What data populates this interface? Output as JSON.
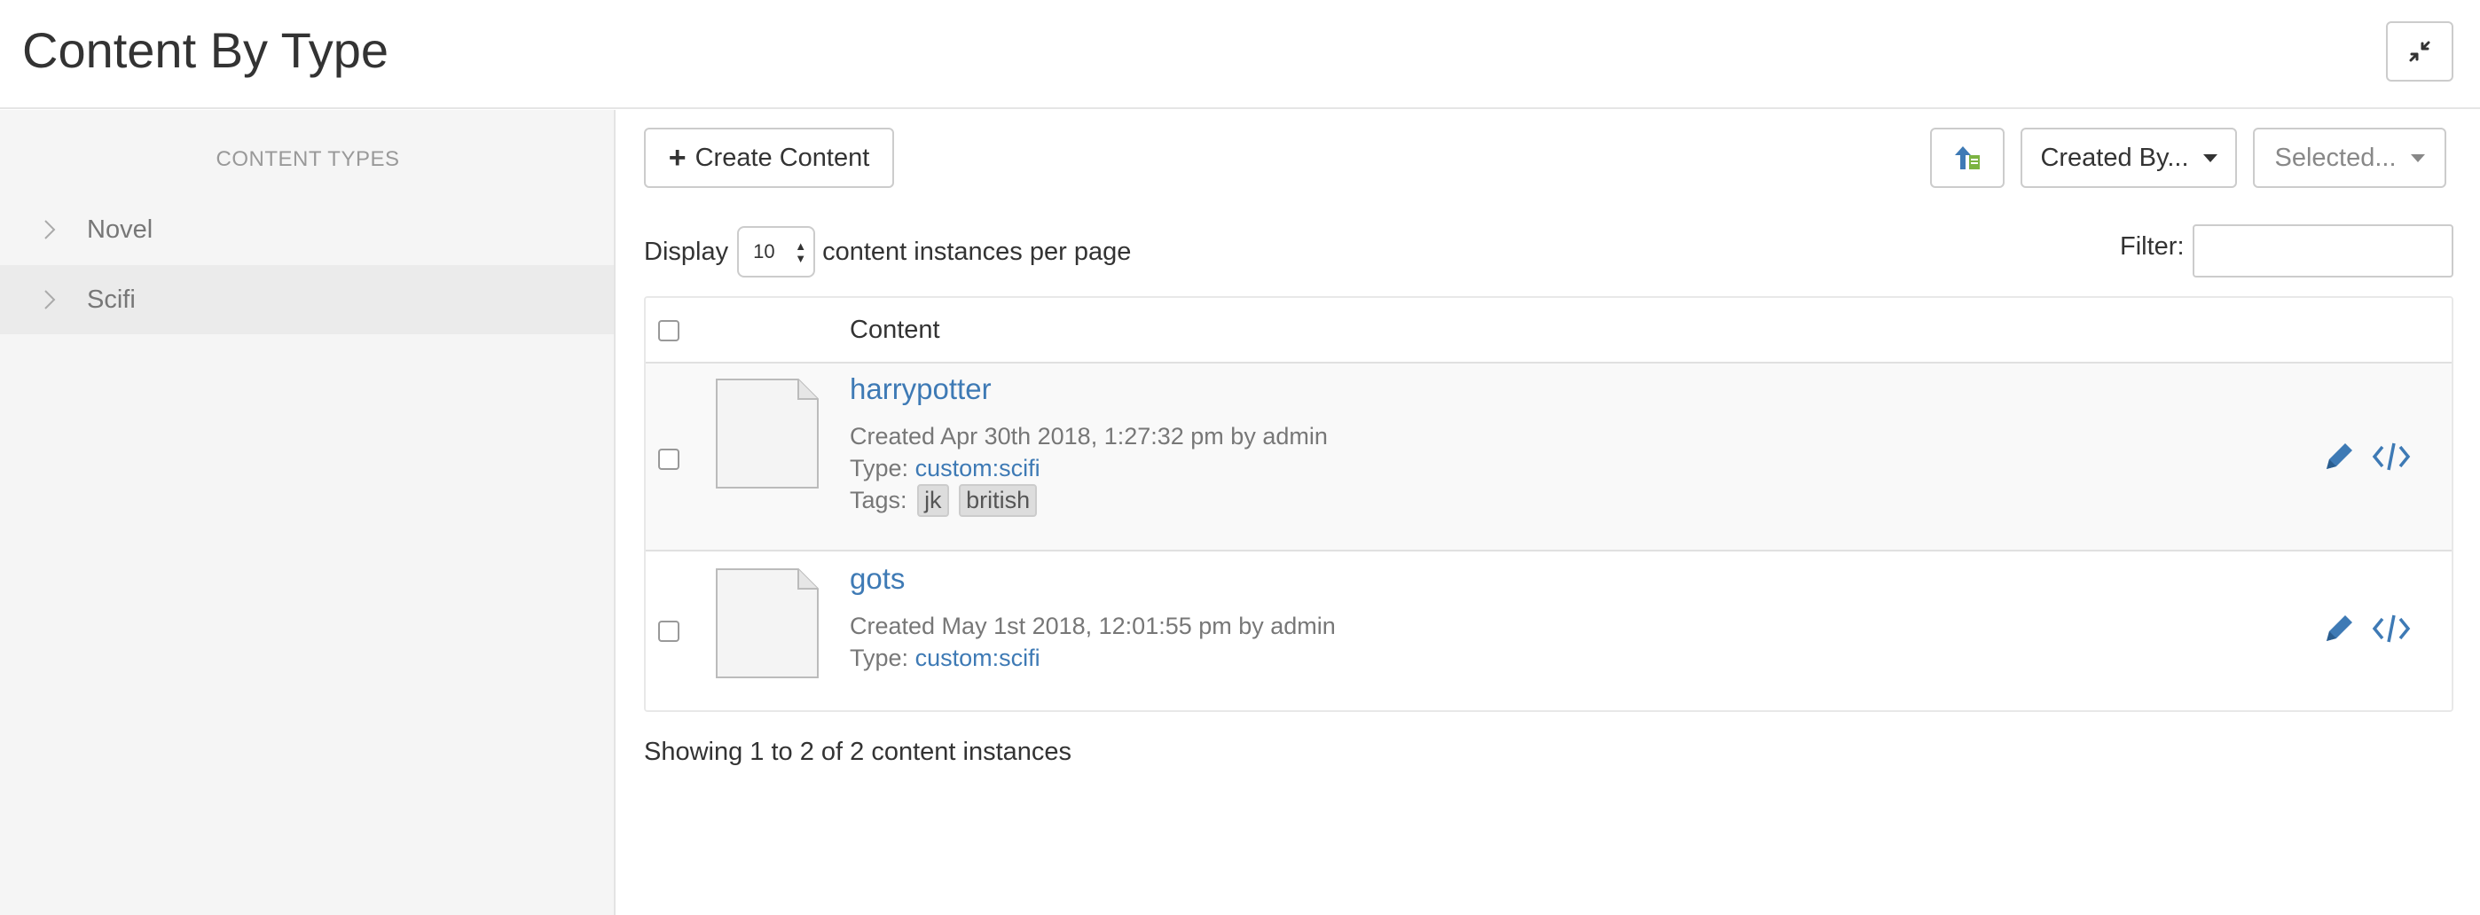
{
  "header": {
    "title": "Content By Type"
  },
  "sidebar": {
    "heading": "CONTENT TYPES",
    "items": [
      {
        "label": "Novel",
        "active": false
      },
      {
        "label": "Scifi",
        "active": true
      }
    ]
  },
  "toolbar": {
    "create_label": "Create Content",
    "created_by_label": "Created By...",
    "selected_label": "Selected..."
  },
  "display": {
    "prefix": "Display",
    "page_size": "10",
    "suffix": "content instances per page",
    "filter_label": "Filter:",
    "filter_value": ""
  },
  "table": {
    "column_header": "Content",
    "rows": [
      {
        "title": "harrypotter",
        "created": "Created Apr 30th 2018, 1:27:32 pm by admin",
        "type_label": "Type:",
        "type_value": "custom:scifi",
        "tags_label": "Tags:",
        "tags": [
          "jk",
          "british"
        ]
      },
      {
        "title": "gots",
        "created": "Created May 1st 2018, 12:01:55 pm by admin",
        "type_label": "Type:",
        "type_value": "custom:scifi"
      }
    ]
  },
  "footer": {
    "summary": "Showing 1 to 2 of 2 content instances"
  },
  "colors": {
    "link": "#3e7ab5",
    "sidebar_bg": "#f5f5f5",
    "active_item_bg": "#ebebeb"
  }
}
